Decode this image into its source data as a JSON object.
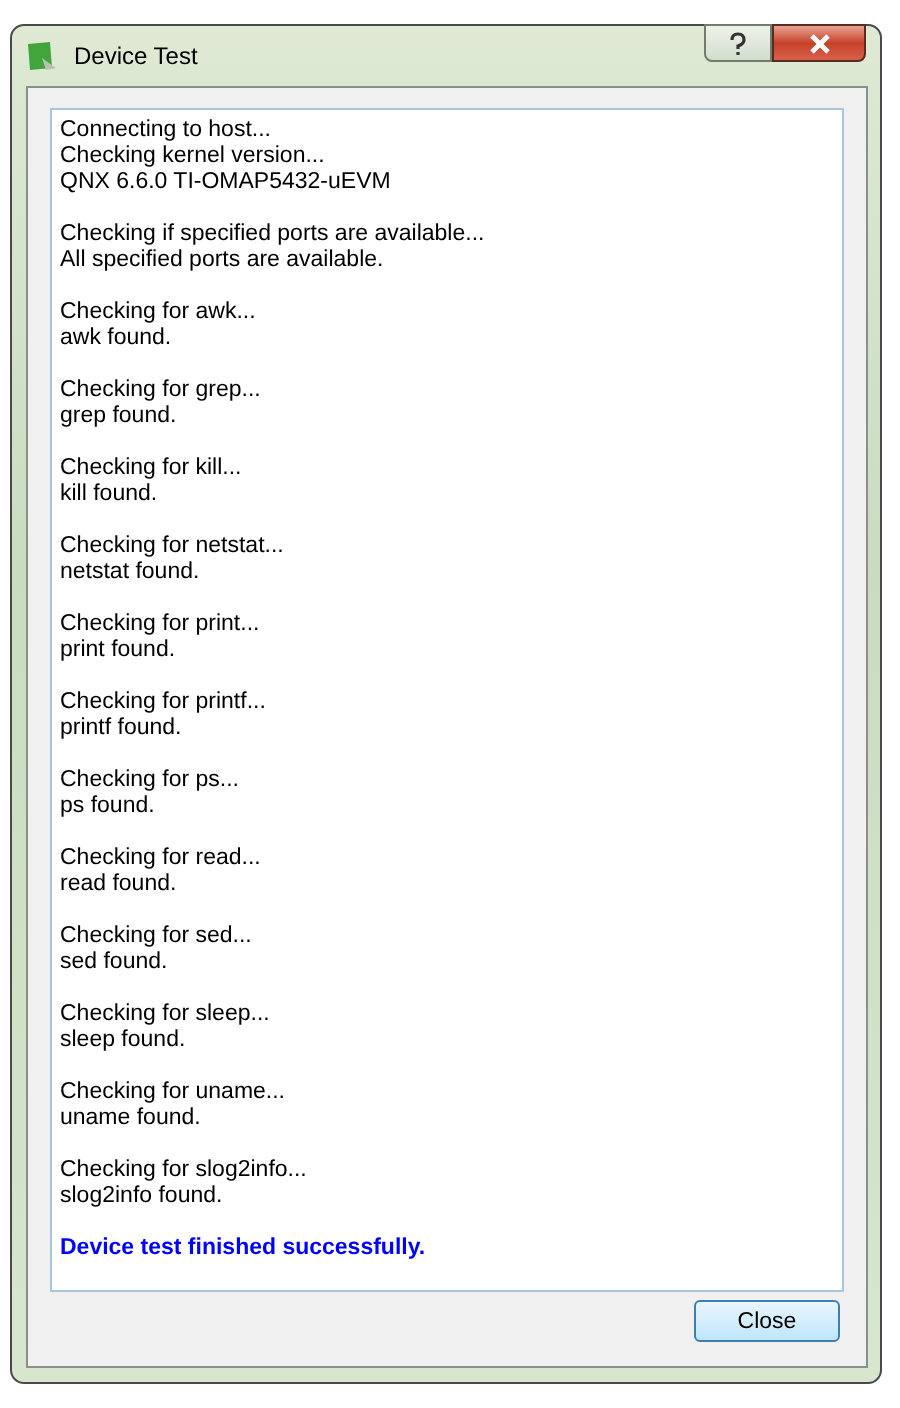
{
  "window": {
    "title": "Device Test"
  },
  "log": [
    {
      "kind": "plain",
      "lines": [
        "Connecting to host...",
        "Checking kernel version...",
        "QNX 6.6.0 TI-OMAP5432-uEVM"
      ]
    },
    {
      "kind": "plain",
      "lines": [
        "Checking if specified ports are available...",
        "All specified ports are available."
      ]
    },
    {
      "kind": "plain",
      "lines": [
        "Checking for awk...",
        "awk found."
      ]
    },
    {
      "kind": "plain",
      "lines": [
        "Checking for grep...",
        "grep found."
      ]
    },
    {
      "kind": "plain",
      "lines": [
        "Checking for kill...",
        "kill found."
      ]
    },
    {
      "kind": "plain",
      "lines": [
        "Checking for netstat...",
        "netstat found."
      ]
    },
    {
      "kind": "plain",
      "lines": [
        "Checking for print...",
        "print found."
      ]
    },
    {
      "kind": "plain",
      "lines": [
        "Checking for printf...",
        "printf found."
      ]
    },
    {
      "kind": "plain",
      "lines": [
        "Checking for ps...",
        "ps found."
      ]
    },
    {
      "kind": "plain",
      "lines": [
        "Checking for read...",
        "read found."
      ]
    },
    {
      "kind": "plain",
      "lines": [
        "Checking for sed...",
        "sed found."
      ]
    },
    {
      "kind": "plain",
      "lines": [
        "Checking for sleep...",
        "sleep found."
      ]
    },
    {
      "kind": "plain",
      "lines": [
        "Checking for uname...",
        "uname found."
      ]
    },
    {
      "kind": "plain",
      "lines": [
        "Checking for slog2info...",
        "slog2info found."
      ]
    },
    {
      "kind": "success",
      "lines": [
        "Device test finished successfully."
      ]
    }
  ],
  "buttons": [
    {
      "label": "Close"
    }
  ]
}
